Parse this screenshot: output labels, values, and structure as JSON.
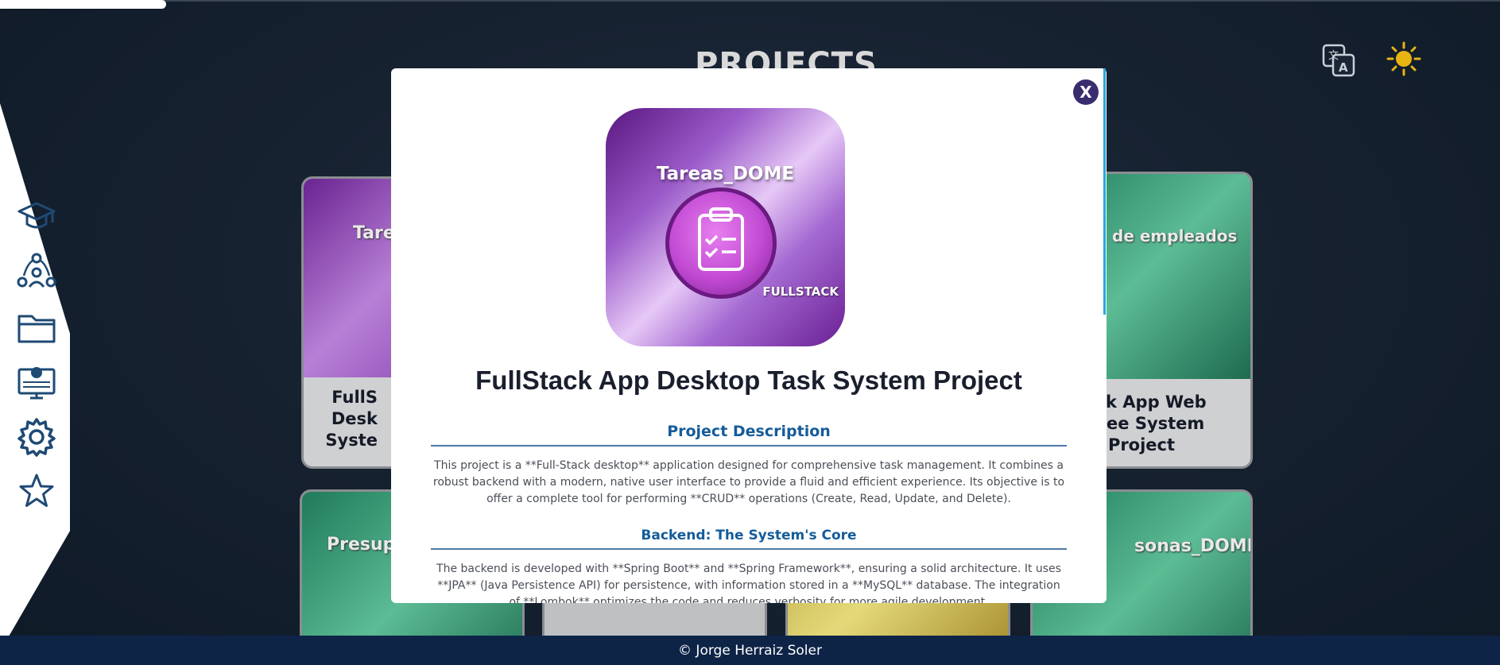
{
  "page": {
    "title": "PROJECTS",
    "footer": "© Jorge Herraiz Soler"
  },
  "header": {
    "translate_icon": "translate-icon",
    "theme_icon": "sun-icon"
  },
  "sidebar": {
    "items": [
      {
        "icon": "graduation-cap-icon"
      },
      {
        "icon": "team-network-icon"
      },
      {
        "icon": "folder-icon"
      },
      {
        "icon": "desktop-portfolio-icon"
      },
      {
        "icon": "gear-icon"
      },
      {
        "icon": "star-icon"
      }
    ]
  },
  "cards": [
    {
      "overlay": "Tare",
      "label": "FullS\nDesk\nSyste"
    },
    {
      "overlay": "de empleados",
      "label": "tack App Web\nloyee System\nProject"
    },
    {
      "overlay": "Presupu"
    },
    {
      "overlay": "sonas_DOME"
    }
  ],
  "modal": {
    "close_label": "X",
    "image": {
      "title": "Tareas_DOME",
      "footer": "FULLSTACK"
    },
    "title": "FullStack App Desktop Task System Project",
    "sections": [
      {
        "title": "Project Description",
        "body": "This project is a **Full-Stack desktop** application designed for comprehensive task management. It combines a robust backend with a modern, native user interface to provide a fluid and efficient experience. Its objective is to offer a complete tool for performing **CRUD** operations (Create, Read, Update, and Delete)."
      },
      {
        "title": "Backend: The System's Core",
        "body": "The backend is developed with **Spring Boot** and **Spring Framework**, ensuring a solid architecture. It uses **JPA** (Java Persistence API) for persistence, with information stored in a **MySQL** database. The integration of **Lombok** optimizes the code and reduces verbosity for more agile development."
      }
    ]
  }
}
